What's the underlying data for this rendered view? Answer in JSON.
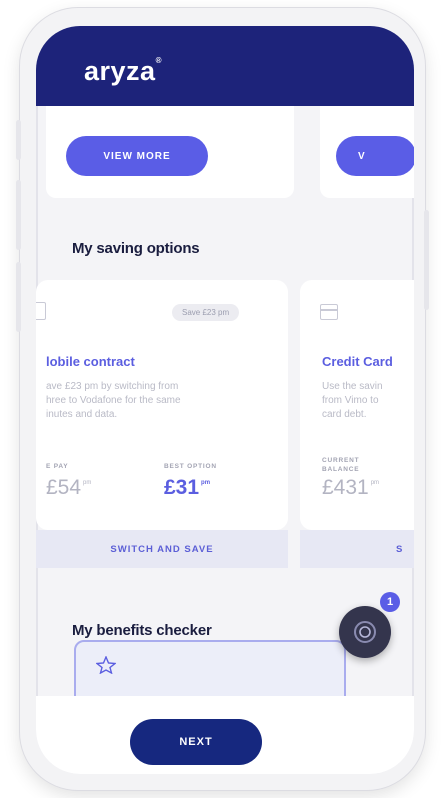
{
  "app": {
    "logo": "aryza",
    "logo_mark": "®"
  },
  "top_cards": {
    "view_more_label": "VIEW MORE",
    "partial_button_label": "V"
  },
  "savings": {
    "title": "My saving options",
    "cards": [
      {
        "badge": "Save £23 pm",
        "title": "Mobile contract",
        "title_visible": "lobile contract",
        "desc_lines": [
          "ave £23 pm by switching from",
          "hree to Vodafone for the same",
          "inutes and data."
        ],
        "current_label": "E PAY",
        "current_price": "£54",
        "current_unit": "pm",
        "best_label": "BEST OPTION",
        "best_price": "£31",
        "best_unit": "pm",
        "footer": "SWITCH AND SAVE"
      },
      {
        "title": "Credit Card",
        "desc_lines": [
          "Use the savin",
          "from Vimo to",
          "card debt."
        ],
        "label_line1": "CURRENT",
        "label_line2": "BALANCE",
        "price": "£431",
        "unit": "pm",
        "footer_partial": "S"
      }
    ]
  },
  "benefits": {
    "title": "My benefits checker"
  },
  "fab": {
    "badge_count": "1"
  },
  "footer": {
    "next_label": "NEXT"
  },
  "colors": {
    "header": "#1d237a",
    "accent": "#5a5de6",
    "next_button": "#16287f",
    "card_title": "#5b5ee0"
  }
}
